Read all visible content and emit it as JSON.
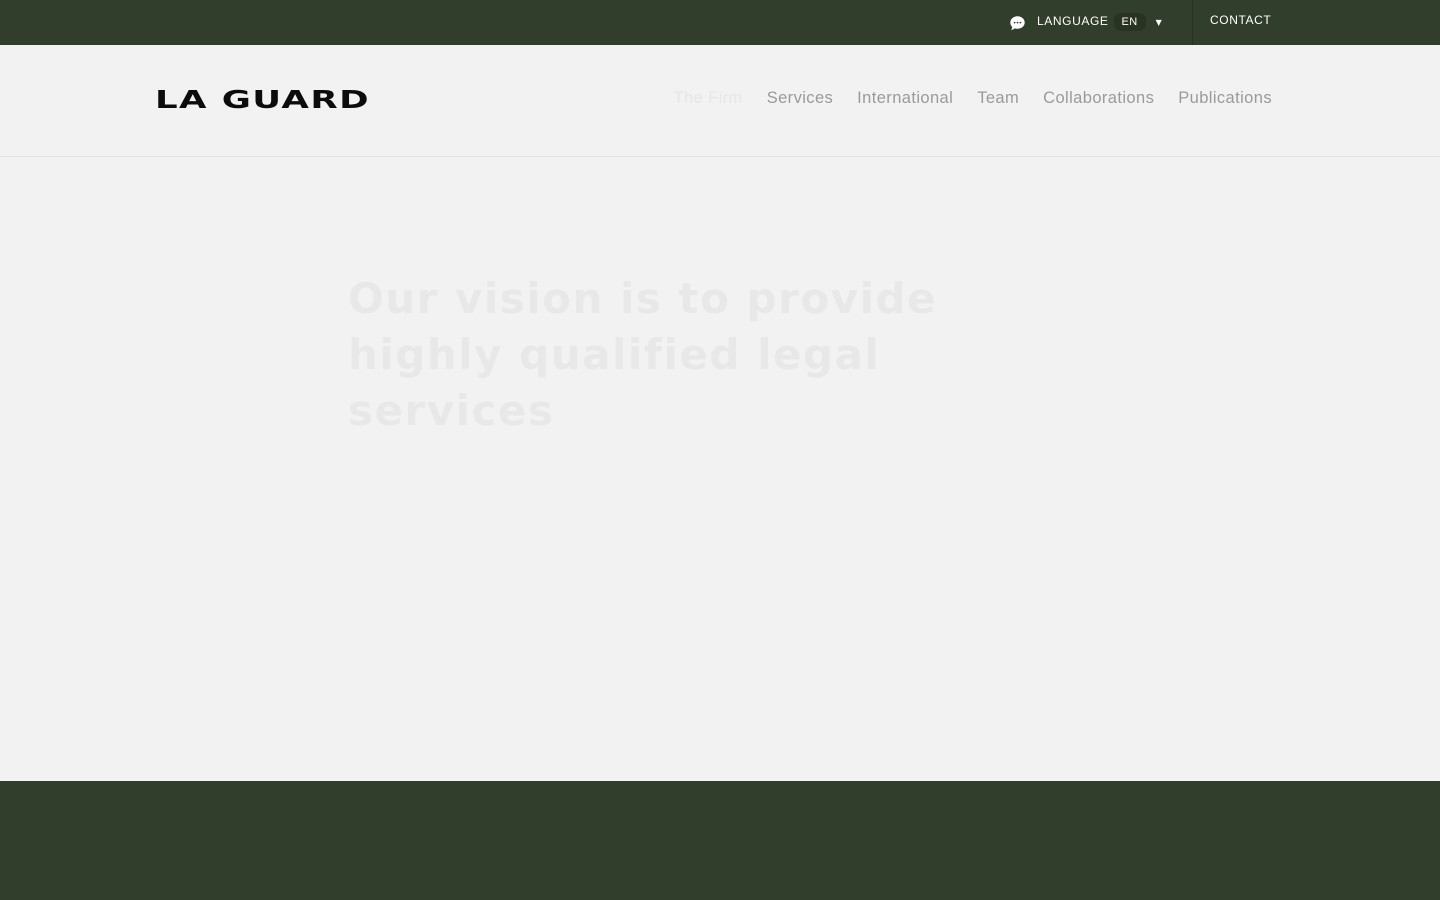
{
  "topbar": {
    "language_icon": "chat-bubble-icon",
    "language_label": "LANGUAGE",
    "language_value": "EN",
    "caret_icon": "caret-down-icon",
    "contact_label": "CONTACT"
  },
  "header": {
    "logo_text": "LA GUARD",
    "nav": [
      {
        "label": "The Firm",
        "active": true
      },
      {
        "label": "Services",
        "active": false
      },
      {
        "label": "International",
        "active": false
      },
      {
        "label": "Team",
        "active": false
      },
      {
        "label": "Collaborations",
        "active": false
      },
      {
        "label": "Publications",
        "active": false
      }
    ]
  },
  "hero": {
    "title": "Our vision is to provide highly qualified legal services"
  },
  "colors": {
    "brand_dark_green": "#313e2b",
    "page_background": "#f2f2f2",
    "logo_black": "#0c0c0c",
    "nav_gray": "#9a9a9a"
  }
}
